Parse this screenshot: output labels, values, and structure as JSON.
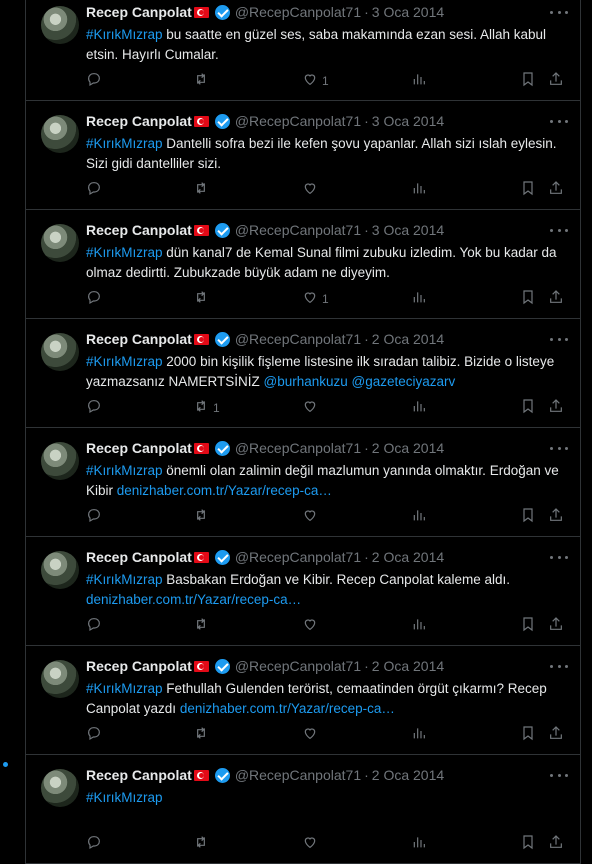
{
  "tweets": [
    {
      "name": "Recep Canpolat",
      "handle": "@RecepCanpolat71",
      "date": "3 Oca 2014",
      "hashtag": "#KırıkMızrap",
      "text": " bu saatte en güzel ses, saba makamında ezan sesi. Allah kabul etsin. Hayırlı Cumalar.",
      "mentions": "",
      "link": "",
      "replies": "",
      "retweets": "",
      "likes": "1"
    },
    {
      "name": "Recep Canpolat",
      "handle": "@RecepCanpolat71",
      "date": "3 Oca 2014",
      "hashtag": "#KırıkMızrap",
      "text": " Dantelli sofra bezi ile kefen şovu yapanlar. Allah sizi ıslah eylesin. Sizi gidi dantelliler sizi.",
      "mentions": "",
      "link": "",
      "replies": "",
      "retweets": "",
      "likes": ""
    },
    {
      "name": "Recep Canpolat",
      "handle": "@RecepCanpolat71",
      "date": "3 Oca 2014",
      "hashtag": "#KırıkMızrap",
      "text": " dün kanal7 de Kemal Sunal filmi zubuku izledim. Yok bu kadar da olmaz dedirtti. Zubukzade büyük adam ne diyeyim.",
      "mentions": "",
      "link": "",
      "replies": "",
      "retweets": "",
      "likes": "1"
    },
    {
      "name": "Recep Canpolat",
      "handle": "@RecepCanpolat71",
      "date": "2 Oca 2014",
      "hashtag": "#KırıkMızrap",
      "text": " 2000 bin kişilik fişleme listesine ilk sıradan talibiz. Bizide o listeye yazmazsanız NAMERTSİNİZ ",
      "mentions": "@burhankuzu @gazeteciyazarv",
      "link": "",
      "replies": "",
      "retweets": "1",
      "likes": ""
    },
    {
      "name": "Recep Canpolat",
      "handle": "@RecepCanpolat71",
      "date": "2 Oca 2014",
      "hashtag": "#KırıkMızrap",
      "text": " önemli olan zalimin değil mazlumun yanında olmaktır. Erdoğan ve  Kibir ",
      "mentions": "",
      "link": "denizhaber.com.tr/Yazar/recep-ca…",
      "replies": "",
      "retweets": "",
      "likes": ""
    },
    {
      "name": "Recep Canpolat",
      "handle": "@RecepCanpolat71",
      "date": "2 Oca 2014",
      "hashtag": "#KırıkMızrap",
      "text": " Basbakan Erdoğan ve Kibir. Recep Canpolat kaleme aldı. ",
      "mentions": "",
      "link": "denizhaber.com.tr/Yazar/recep-ca…",
      "replies": "",
      "retweets": "",
      "likes": ""
    },
    {
      "name": "Recep Canpolat",
      "handle": "@RecepCanpolat71",
      "date": "2 Oca 2014",
      "hashtag": "#KırıkMızrap",
      "text": " Fethullah Gulenden terörist, cemaatinden örgüt çıkarmı? Recep Canpolat yazdı ",
      "mentions": "",
      "link": "denizhaber.com.tr/Yazar/recep-ca…",
      "replies": "",
      "retweets": "",
      "likes": ""
    },
    {
      "name": "Recep Canpolat",
      "handle": "@RecepCanpolat71",
      "date": "2 Oca 2014",
      "hashtag": "#KırıkMızrap",
      "text": "",
      "mentions": "",
      "link": "",
      "replies": "",
      "retweets": "",
      "likes": ""
    }
  ],
  "icons": {
    "avatar": "profile-photo",
    "flag": "turkey-flag-icon",
    "verified": "verified-badge-icon",
    "more": "more-icon",
    "reply": "reply-icon",
    "retweet": "retweet-icon",
    "like": "like-icon",
    "views": "views-icon",
    "bookmark": "bookmark-icon",
    "share": "share-icon"
  },
  "colors": {
    "background": "#000000",
    "text": "#e7e9ea",
    "muted": "#71767b",
    "accent": "#1d9bf0",
    "border": "#2f3336"
  }
}
